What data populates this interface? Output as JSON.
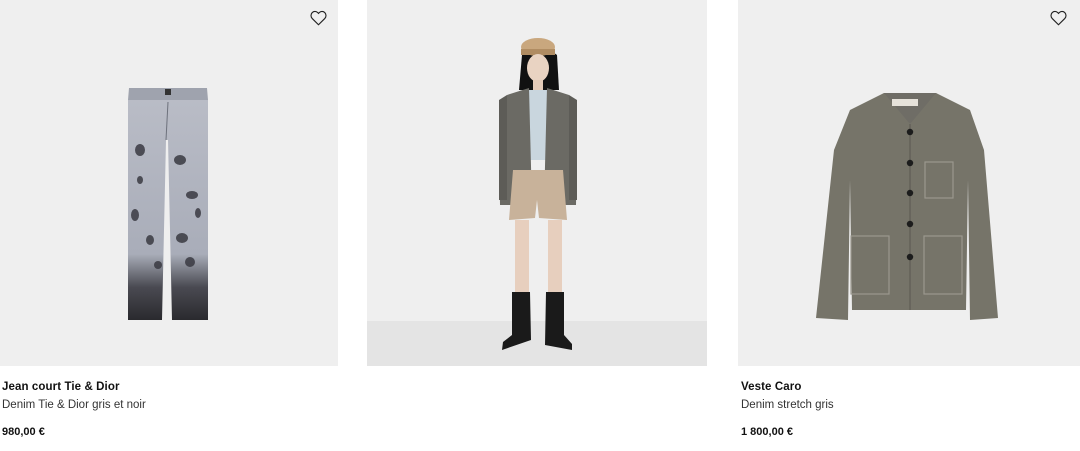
{
  "products": [
    {
      "name": "Jean court Tie & Dior",
      "subtitle": "Denim Tie & Dior gris et noir",
      "price": "980,00 €",
      "favorite_icon": "heart-outline-icon"
    },
    {
      "image_only": true
    },
    {
      "name": "Veste Caro",
      "subtitle": "Denim stretch gris",
      "price": "1 800,00 €",
      "favorite_icon": "heart-outline-icon"
    }
  ],
  "colors": {
    "image_background": "#efefef",
    "text": "#111111"
  }
}
